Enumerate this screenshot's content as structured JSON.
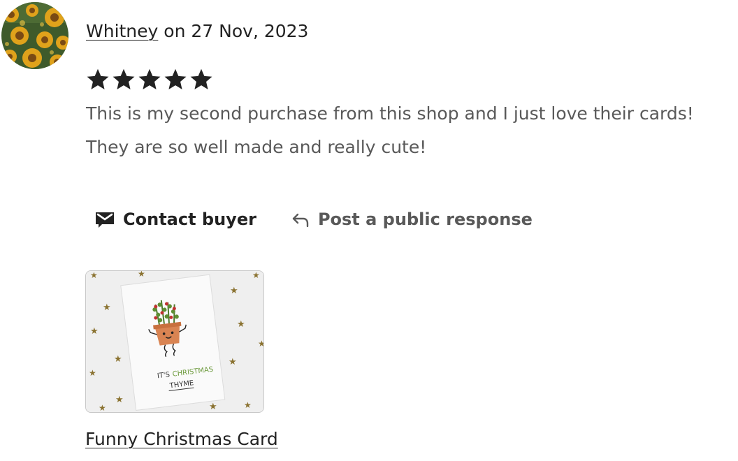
{
  "review": {
    "reviewer_name": "Whitney",
    "date_prefix": " on ",
    "date": "27 Nov, 2023",
    "rating": 5,
    "max_rating": 5,
    "text": "This is my second purchase from this shop and I just love their cards! They are so well made and really cute!"
  },
  "actions": {
    "contact_label": "Contact buyer",
    "contact_icon": "envelope-icon",
    "respond_label": "Post a public response",
    "respond_icon": "reply-arrow-icon"
  },
  "product": {
    "card_line1_a": "IT'S",
    "card_line1_b": "CHRISTMAS",
    "card_line2": "THYME",
    "link_label": "Funny Christmas Card"
  },
  "colors": {
    "text_primary": "#222222",
    "text_secondary": "#595959",
    "star": "#222222",
    "card_green": "#6c9a3c",
    "pot": "#d98452"
  }
}
